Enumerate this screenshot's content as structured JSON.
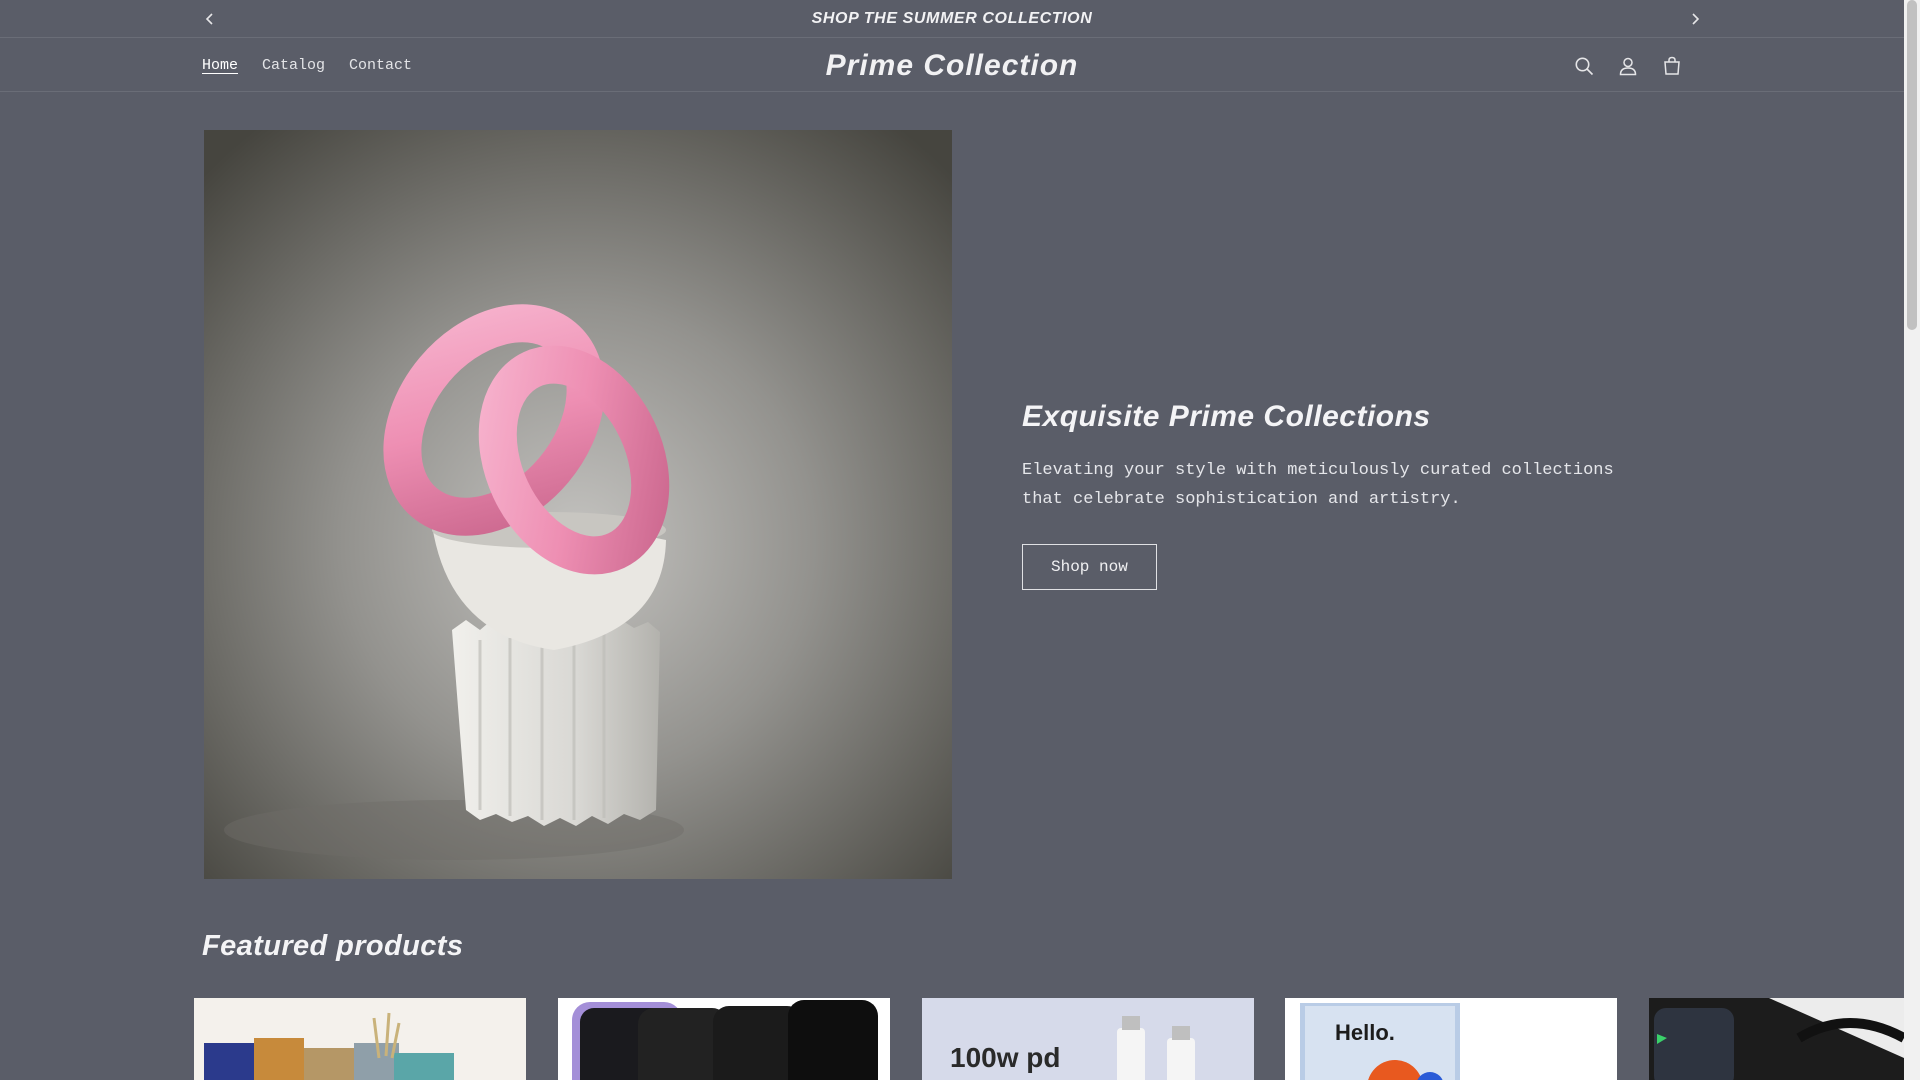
{
  "announcement": {
    "text": "SHOP THE SUMMER COLLECTION"
  },
  "header": {
    "logo": "Prime Collection",
    "nav": [
      {
        "label": "Home",
        "active": true
      },
      {
        "label": "Catalog",
        "active": false
      },
      {
        "label": "Contact",
        "active": false
      }
    ],
    "icons": [
      "search-icon",
      "account-icon",
      "cart-icon"
    ]
  },
  "hero": {
    "title": "Exquisite Prime Collections",
    "description": "Elevating your style with meticulously curated collections that celebrate sophistication and artistry.",
    "button": "Shop now"
  },
  "featured": {
    "title": "Featured products",
    "products": [
      {
        "image_text": ""
      },
      {
        "image_text": ""
      },
      {
        "image_text": "100w pd"
      },
      {
        "image_text": "Hello."
      },
      {
        "image_text": ""
      }
    ]
  },
  "colors": {
    "background": "#5a5d68",
    "text": "#f4f4f6",
    "accent_pink": "#ee8fb3"
  }
}
